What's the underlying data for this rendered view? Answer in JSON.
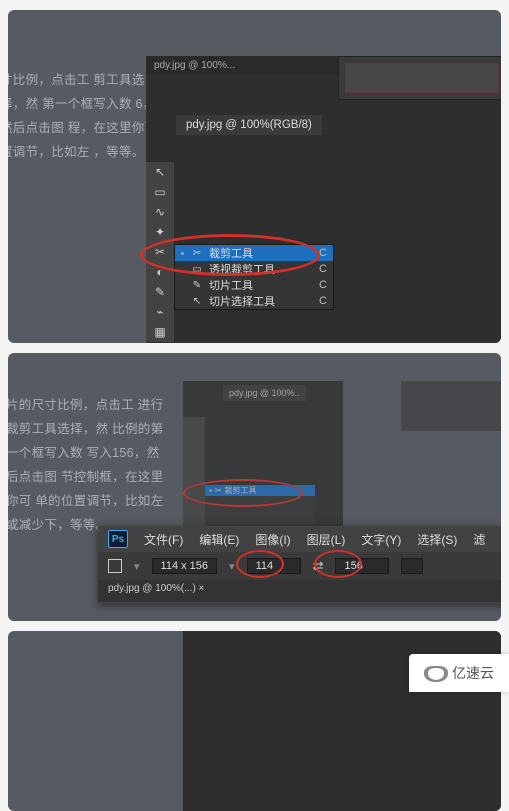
{
  "card1": {
    "blurb": "寸比例，点击工 剪工具选择，然 第一个框写入数 6，然后点击图 程，在这里你可 置调节，比如左 ，等等。",
    "tab": "pdy.jpg @ 100%(RGB/8)",
    "title_hint": "pdy.jpg @ 100%...",
    "flyout": {
      "items": [
        {
          "label": "裁剪工具",
          "key": "C",
          "active": true
        },
        {
          "label": "透视裁剪工具",
          "key": "C",
          "active": false
        },
        {
          "label": "切片工具",
          "key": "C",
          "active": false
        },
        {
          "label": "切片选择工具",
          "key": "C",
          "active": false
        }
      ]
    }
  },
  "card2": {
    "blurb": "片的尺寸比例，点击工 进行裁剪工具选择，然 比例的第一个框写入数 写入156，然后点击图 节控制框，在这里你可 单的位置调节，比如左 或减少下，等等。",
    "menubar": {
      "items": [
        "文件(F)",
        "编辑(E)",
        "图像(I)",
        "图层(L)",
        "文字(Y)",
        "选择(S)",
        "滤"
      ]
    },
    "options": {
      "ratio": "114 x 156",
      "w": "114",
      "h": "156"
    },
    "filetab": "pdy.jpg @ 100%(...) ×",
    "mini_tab": "pdy.jpg @ 100%..",
    "mini_fly_label": "裁剪工具"
  },
  "brand": {
    "text": "亿速云"
  },
  "icons": {
    "move": "↖",
    "marquee": "▭",
    "lasso": "∿",
    "wand": "✦",
    "crop": "✂",
    "eyedrop": "◐",
    "brush": "✎",
    "stamp": "⌁",
    "history": "↺",
    "gradient": "▦",
    "dot": "▪"
  },
  "colors": {
    "annotation": "#d4302a"
  }
}
